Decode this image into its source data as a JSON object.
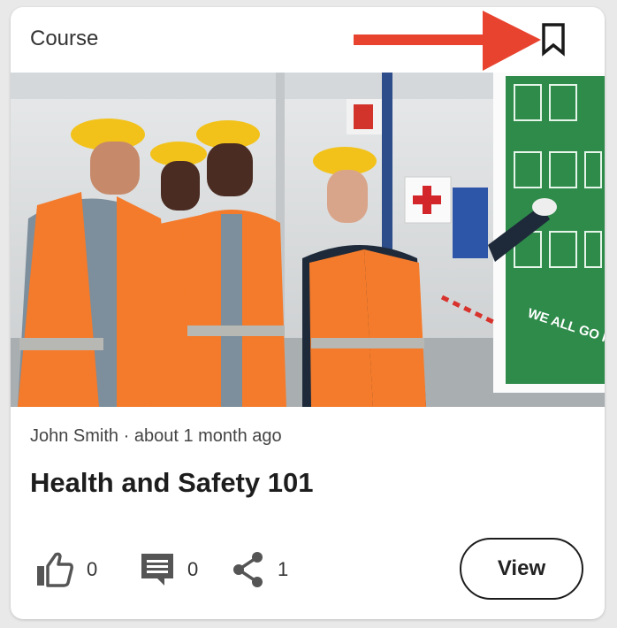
{
  "card": {
    "type_label": "Course",
    "author": "John Smith",
    "separator": " · ",
    "posted": "about 1 month ago",
    "title": "Health and Safety 101",
    "image": {
      "sign_text": "WE ALL GO HOME SAFE."
    },
    "actions": {
      "likes": "0",
      "comments": "0",
      "shares": "1"
    },
    "view_label": "View"
  },
  "colors": {
    "annotation_arrow": "#e8432f",
    "hi_vis_vest": "#f47b2b",
    "hard_hat": "#f2c21a",
    "safety_board": "#2e8b4a",
    "icon": "#555555"
  },
  "icons": [
    "bookmark-icon",
    "thumbs-up-icon",
    "comment-icon",
    "share-icon"
  ]
}
